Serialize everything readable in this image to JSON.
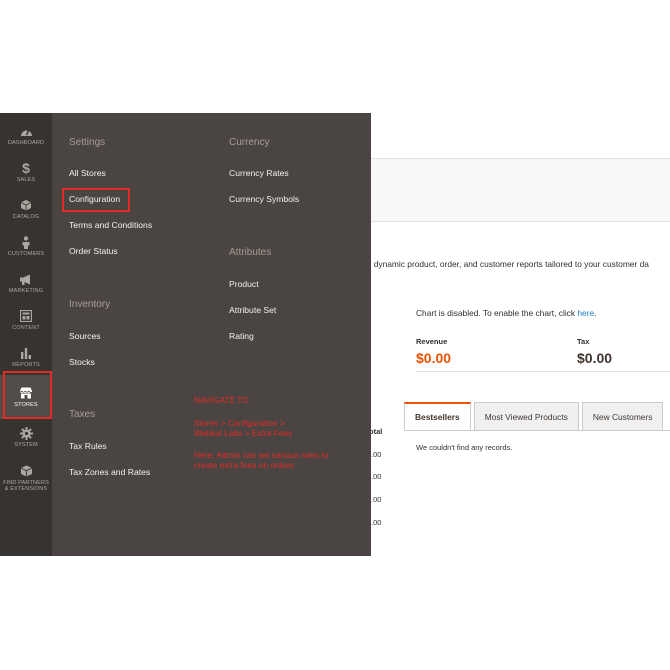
{
  "sidebar": {
    "items": [
      {
        "label": "Dashboard",
        "icon": "dashboard-icon"
      },
      {
        "label": "Sales",
        "icon": "dollar-icon"
      },
      {
        "label": "Catalog",
        "icon": "box-icon"
      },
      {
        "label": "Customers",
        "icon": "person-icon"
      },
      {
        "label": "Marketing",
        "icon": "megaphone-icon"
      },
      {
        "label": "Content",
        "icon": "layout-icon"
      },
      {
        "label": "Reports",
        "icon": "bar-chart-icon"
      },
      {
        "label": "Stores",
        "icon": "storefront-icon"
      },
      {
        "label": "System",
        "icon": "gear-icon"
      },
      {
        "label": "Find Partners & Extensions",
        "icon": "extension-box-icon"
      }
    ],
    "active_item": "Stores"
  },
  "flyout": {
    "settings": {
      "title": "Settings",
      "links": [
        "All Stores",
        "Configuration",
        "Terms and Conditions",
        "Order Status"
      ]
    },
    "inventory": {
      "title": "Inventory",
      "links": [
        "Sources",
        "Stocks"
      ]
    },
    "taxes": {
      "title": "Taxes",
      "links": [
        "Tax Rules",
        "Tax Zones and Rates"
      ]
    },
    "currency": {
      "title": "Currency",
      "links": [
        "Currency Rates",
        "Currency Symbols"
      ]
    },
    "attributes": {
      "title": "Attributes",
      "links": [
        "Product",
        "Attribute Set",
        "Rating"
      ]
    },
    "highlighted_link": "Configuration"
  },
  "annotation": {
    "heading": "NAVIGATE TO",
    "path_line1": "Stores > Configuration >",
    "path_line2": "Webkul Labs > Extra Fees",
    "desc_line1": "Here, Admin can set various rules to",
    "desc_line2": "create extra fees on orders"
  },
  "dashboard": {
    "intro_text": "ur dynamic product, order, and customer reports tailored to your customer da",
    "chart_msg": "Chart is disabled. To enable the chart, click ",
    "chart_link": "here",
    "chart_msg_end": ".",
    "revenue_label": "Revenue",
    "revenue_value": "$0.00",
    "tax_label": "Tax",
    "tax_value": "$0.00",
    "tabs": [
      "Bestsellers",
      "Most Viewed Products",
      "New Customers"
    ],
    "active_tab": "Bestsellers",
    "no_records": "We couldn't find any records.",
    "table_header_partial": "otal",
    "table_cells_partial": [
      ".00",
      ".00",
      ".00",
      ".00"
    ]
  },
  "colors": {
    "sidebar_bg": "#373330",
    "flyout_bg": "#4a4542",
    "highlight_red": "#e02b27",
    "revenue_orange": "#eb5202",
    "link_blue": "#1979c3"
  }
}
